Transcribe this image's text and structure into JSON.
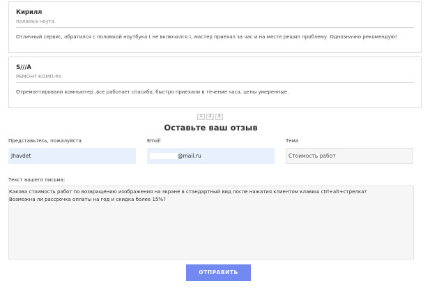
{
  "reviews": [
    {
      "name": "Кирилл",
      "subtitle": "поломка ноута",
      "text": "Отличный сервис, обратился с поломкой ноутбука ( не включался ), мастер приехал за час и на месте решил проблему. Однозначно рекомендую!"
    },
    {
      "name": "S///A",
      "subtitle": "РЕМОНТ КОМП-РА",
      "text": "Отремонтировали компьютер ,все работает спасибо, быстро приехали в течение часа, цены умеренные."
    }
  ],
  "pagination": {
    "pages": [
      "1",
      "2",
      "3"
    ]
  },
  "form": {
    "title": "Оставьте ваш отзыв",
    "name_label": "Представьтесь, пожалуйста",
    "name_value": "Jhavdet",
    "email_label": "Email",
    "email_value": "@mail.ru",
    "topic_label": "Тема",
    "topic_placeholder": "Стоимость работ",
    "message_label": "Текст вашего письма:",
    "message_lines": [
      "Какова стоимость работ по возвращению изображения на экране в стандартный вид после нажатия клиентом клавиш ctrl+alt+стрелка?",
      "Возможна ли рассрочка оплаты на год и скидка более 15%?"
    ],
    "submit_label": "ОТПРАВИТЬ"
  },
  "colors": {
    "accent": "#7289f2",
    "autofill": "#e8f0fe",
    "input_bg": "#f6f6f6"
  }
}
